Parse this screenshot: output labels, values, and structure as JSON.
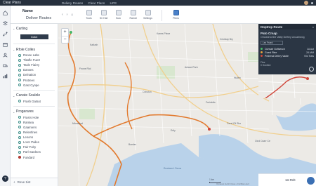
{
  "app": {
    "title": "Clear Plans",
    "main_title": "Name",
    "subtitle": "Deliver Routes"
  },
  "breadcrumbs": [
    "Deliery Routes",
    "Clear Plans",
    "LIFE"
  ],
  "nav": {
    "back": "‹",
    "forward": "›",
    "home": "⌂"
  },
  "toolbar": {
    "items": [
      {
        "label": "Tools",
        "icon": "grid-icon"
      },
      {
        "label": "Sir Hall",
        "icon": "layers-icon"
      },
      {
        "label": "Sulo",
        "icon": "clipboard-icon"
      },
      {
        "label": "Ramid",
        "icon": "pin-icon"
      },
      {
        "label": "Settings",
        "icon": "gear-icon"
      },
      {
        "label": "Plens",
        "icon": "save-icon"
      }
    ]
  },
  "sidebar": {
    "section_1": {
      "title": "Carting",
      "button": "Gotct"
    },
    "section_2": {
      "title": "Rfole Colles",
      "items": [
        "Rsone Lalte",
        "Tlasfle Fuert",
        "Tasle Fiairry",
        "Danses",
        "Delnation",
        "Protrees",
        "Gast Cynpe"
      ]
    },
    "section_3": {
      "title": "Canate Soulole",
      "items": [
        "Frash Gatsut"
      ]
    },
    "section_4": {
      "title": "Progarares",
      "items": [
        "Frasrs Hole",
        "Ramtea",
        "Gaamrers",
        "Relentlnes",
        "Lenons",
        "Lorer Pailes",
        "Fair Fulry",
        "Parl Sardnes",
        "Fundard"
      ],
      "highlighted": "Fundard"
    },
    "footer": "Reve 1ist"
  },
  "panel": {
    "header": "Doptrep Route",
    "close": "×",
    "route_title": "Pato Crsap",
    "route_sub": "Omoedrnd the Valtly Delfery Unoatinedg",
    "dropdown": "Lez Frued",
    "stops": [
      {
        "name": "Cuhvatr Goflsesch",
        "value": "1A Aut",
        "color": "#48b968"
      },
      {
        "name": "Guesl Rlee",
        "value": "2A MM",
        "color": "#e6a23c"
      },
      {
        "name": "Pedersd Delirry Vaufe",
        "value": "Viis Tlats",
        "color": "#d0463a"
      }
    ],
    "meta": [
      "Flee",
      "0 Oonlted"
    ]
  },
  "map_labels": {
    "water": "Bcaiand Osna",
    "places": [
      "Kaliunh",
      "Kanes Pleoe",
      "Ceviclay Bry",
      "Fnone Rlol",
      "Anlaod Parh",
      "Hutlen",
      "Crinoton",
      "Freinlotls",
      "Mtnnsdad",
      "Ertly",
      "Ceral Ctl Sho",
      "Ctrol Cnarr Ce",
      "Boeder"
    ]
  },
  "scale_text": "1 km",
  "attribution": "Opnasst Gohh Opas • Fsi/Man Aerl",
  "bottom_action": "1st Rnlt",
  "colors": {
    "route": "#e27a2e",
    "accent": "#3b6fb3",
    "panel": "#2b3644",
    "water": "#b9d2ea"
  }
}
